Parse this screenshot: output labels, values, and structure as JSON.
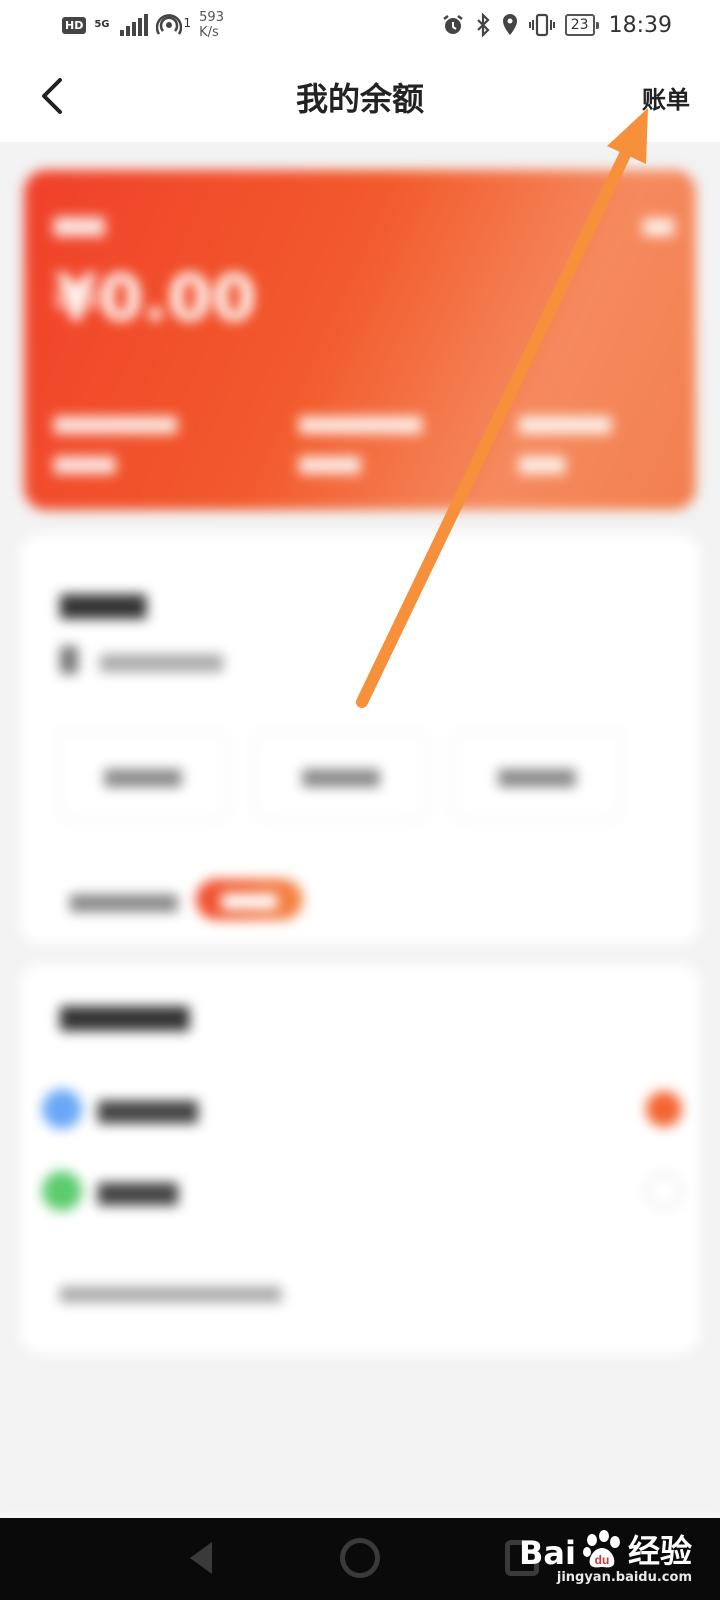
{
  "status_bar": {
    "hd": "HD",
    "network": "5G",
    "wifi_sub": "1",
    "net_speed_value": "593",
    "net_speed_unit": "K/s",
    "battery": "23",
    "time": "18:39"
  },
  "nav": {
    "title": "我的余额",
    "bill_label": "账单"
  },
  "balance_card": {
    "amount": "¥0.00"
  },
  "colors": {
    "card_gradient_start": "#f0402a",
    "card_gradient_end": "#f58a5e",
    "accent": "#f46531",
    "arrow": "#f7903a"
  },
  "watermark": {
    "brand": "Bai",
    "brand_cn": "经验",
    "site": "jingyan.baidu.com"
  }
}
